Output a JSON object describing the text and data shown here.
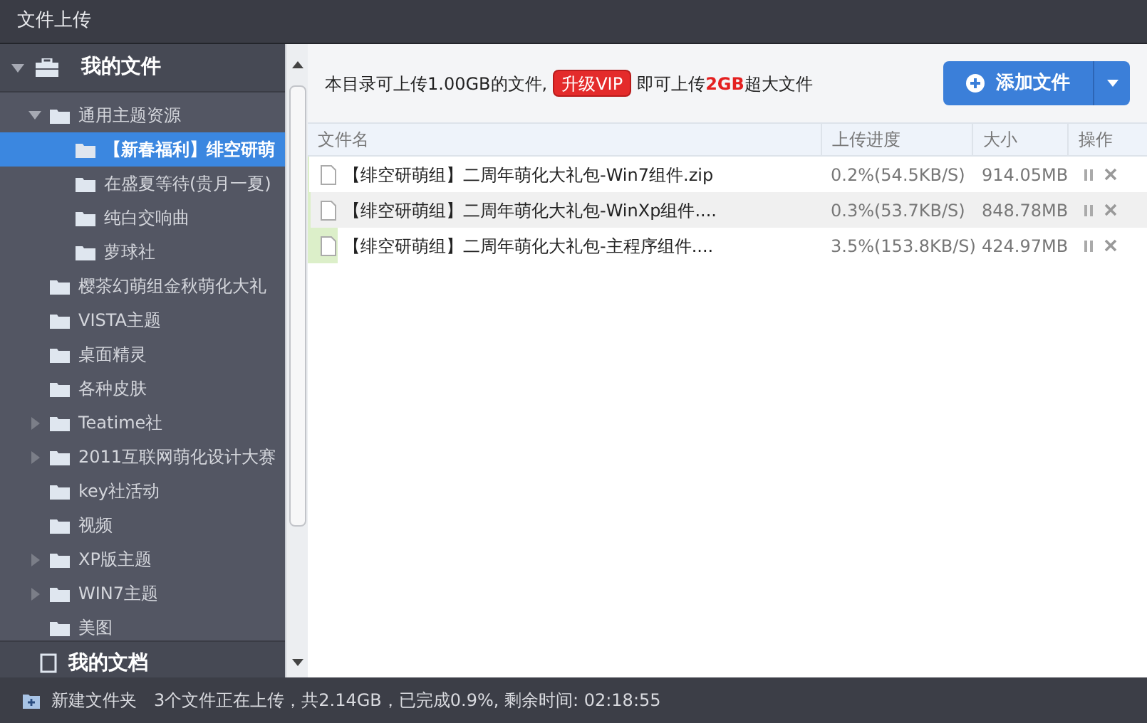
{
  "window": {
    "title": "文件上传"
  },
  "sidebar": {
    "header": {
      "label": "我的文件",
      "expanded": true
    },
    "tree": [
      {
        "label": "通用主题资源",
        "expanded": true,
        "selected": false,
        "children": [
          {
            "label": "【新春福利】绯空研萌",
            "selected": true
          },
          {
            "label": "在盛夏等待(贵月一夏)",
            "selected": false
          },
          {
            "label": "纯白交响曲",
            "selected": false
          },
          {
            "label": "萝球社",
            "selected": false
          }
        ]
      },
      {
        "label": "樱茶幻萌组金秋萌化大礼",
        "selected": false
      },
      {
        "label": "VISTA主题",
        "selected": false
      },
      {
        "label": "桌面精灵",
        "selected": false
      },
      {
        "label": "各种皮肤",
        "selected": false
      },
      {
        "label": "Teatime社",
        "expanded": false,
        "selected": false
      },
      {
        "label": "2011互联网萌化设计大赛",
        "expanded": false,
        "selected": false
      },
      {
        "label": "key社活动",
        "selected": false
      },
      {
        "label": "视频",
        "selected": false
      },
      {
        "label": "XP版主题",
        "expanded": false,
        "selected": false
      },
      {
        "label": "WIN7主题",
        "expanded": false,
        "selected": false
      },
      {
        "label": "美图",
        "selected": false
      }
    ],
    "footer": {
      "label": "我的文档"
    }
  },
  "notice": {
    "text_before": "本目录可上传1.00GB的文件,",
    "vip_button": "升级VIP",
    "text_after": "即可上传**2GB**超大文件"
  },
  "add_button": {
    "label": "添加文件"
  },
  "table": {
    "columns": [
      "文件名",
      "上传进度",
      "大小",
      "操作"
    ],
    "rows": [
      {
        "name": "【绯空研萌组】二周年萌化大礼包-Win7组件.zip",
        "progress": "0.2%(54.5KB/S)",
        "size": "914.05MB",
        "level": 0.002,
        "selected": false
      },
      {
        "name": "【绯空研萌组】二周年萌化大礼包-WinXp组件....",
        "progress": "0.3%(53.7KB/S)",
        "size": "848.78MB",
        "level": 0.003,
        "selected": true
      },
      {
        "name": "【绯空研萌组】二周年萌化大礼包-主程序组件....",
        "progress": "3.5%(153.8KB/S)",
        "size": "424.97MB",
        "level": 0.035,
        "selected": false
      }
    ]
  },
  "status_bar": {
    "new_folder": "新建文件夹",
    "summary": "3个文件正在上传，共2.14GB，已完成0.9%, 剩余时间: 02:18:55"
  }
}
